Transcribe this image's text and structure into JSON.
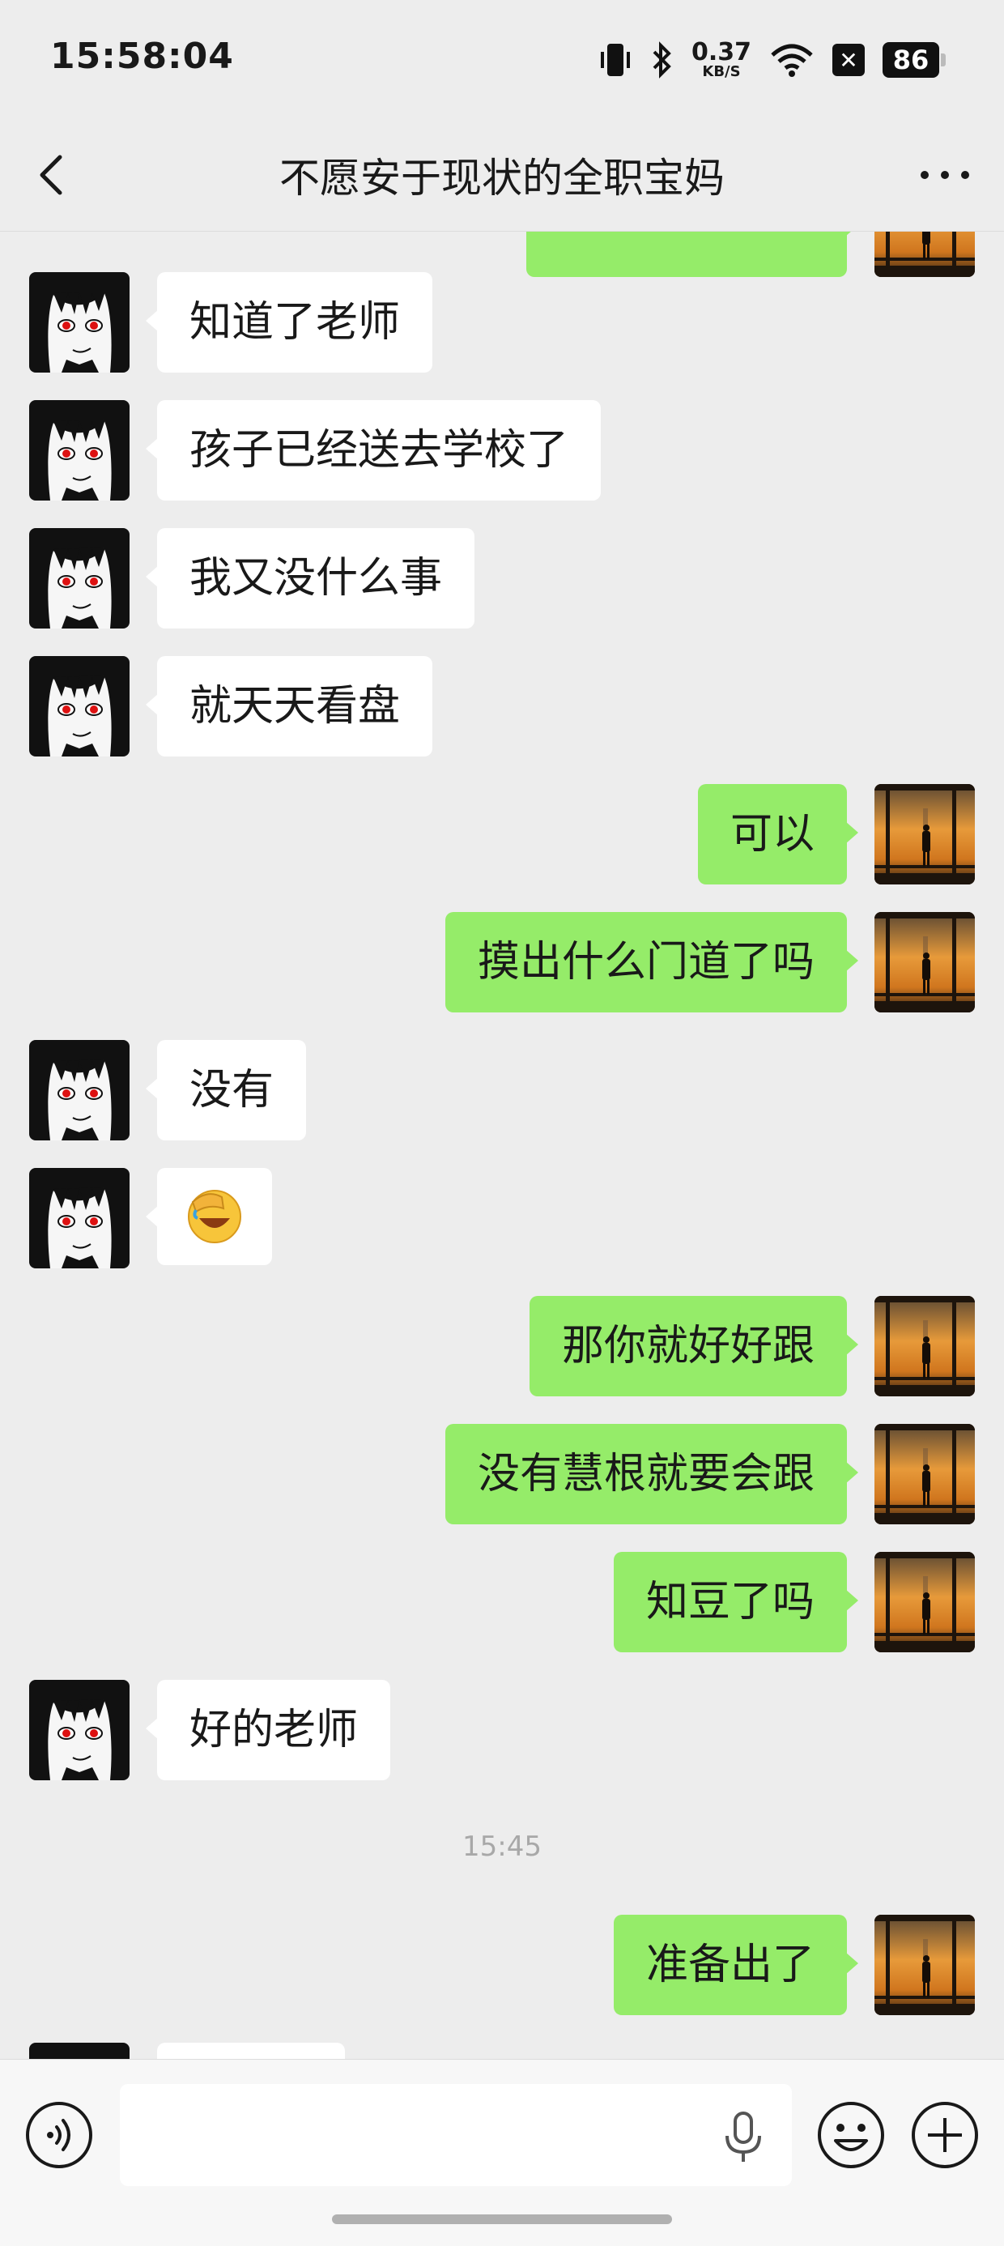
{
  "status_bar": {
    "time": "15:58:04",
    "net_speed": "0.37",
    "net_unit": "KB/S",
    "battery": "86",
    "icons": [
      "vibrate-icon",
      "bluetooth-icon",
      "wifi-icon",
      "x-app-icon",
      "battery-icon"
    ]
  },
  "header": {
    "title": "不愿安于现状的全职宝妈",
    "back_icon": "chevron-left-icon",
    "more_icon": "more-dots-icon"
  },
  "messages": [
    {
      "side": "left",
      "text": "知道了老师"
    },
    {
      "side": "left",
      "text": "孩子已经送去学校了"
    },
    {
      "side": "left",
      "text": "我又没什么事"
    },
    {
      "side": "left",
      "text": "就天天看盘"
    },
    {
      "side": "right",
      "text": "可以"
    },
    {
      "side": "right",
      "text": "摸出什么门道了吗"
    },
    {
      "side": "left",
      "text": "没有"
    },
    {
      "side": "left",
      "text": "🤦",
      "emoji": true
    },
    {
      "side": "right",
      "text": "那你就好好跟"
    },
    {
      "side": "right",
      "text": "没有慧根就要会跟"
    },
    {
      "side": "right",
      "text": "知豆了吗"
    },
    {
      "side": "left",
      "text": "好的老师"
    },
    {
      "side": "right",
      "text": "准备出了"
    }
  ],
  "timestamp": "15:45",
  "input_bar": {
    "placeholder": "",
    "icons": [
      "voice-icon",
      "mic-icon",
      "emoji-icon",
      "plus-icon"
    ]
  },
  "colors": {
    "background": "#ededed",
    "own_bubble": "#95ec69",
    "other_bubble": "#ffffff",
    "timestamp": "#a8a8a8"
  }
}
